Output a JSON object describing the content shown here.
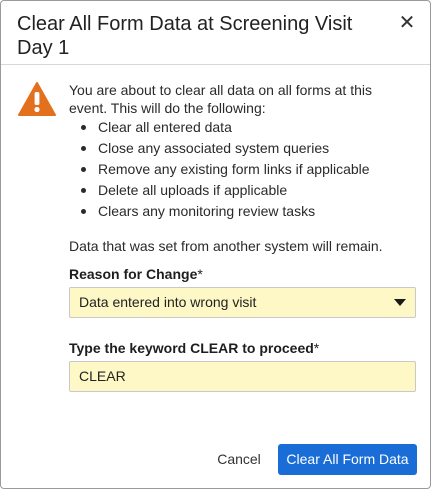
{
  "dialog": {
    "title": "Clear All Form Data at Screening Visit Day 1",
    "close_glyph": "✕",
    "warning_icon": "warning-triangle-icon",
    "accent_color": "#e2701d",
    "intro": "You are about to clear all data on all forms at this event. This will do the following:",
    "bullets": [
      "Clear all entered data",
      "Close any associated system queries",
      "Remove any existing form links if applicable",
      "Delete all uploads if applicable",
      "Clears any monitoring review tasks"
    ],
    "remain_note": "Data that was set from another system will remain.",
    "reason_label": "Reason for Change",
    "reason_required": "*",
    "reason_value": "Data entered into wrong visit",
    "keyword_label": "Type the keyword CLEAR to proceed",
    "keyword_required": "*",
    "keyword_value": "CLEAR",
    "cancel_label": "Cancel",
    "submit_label": "Clear All Form Data",
    "submit_color": "#1a6dd6",
    "field_bg_color": "#fdf8c5"
  }
}
